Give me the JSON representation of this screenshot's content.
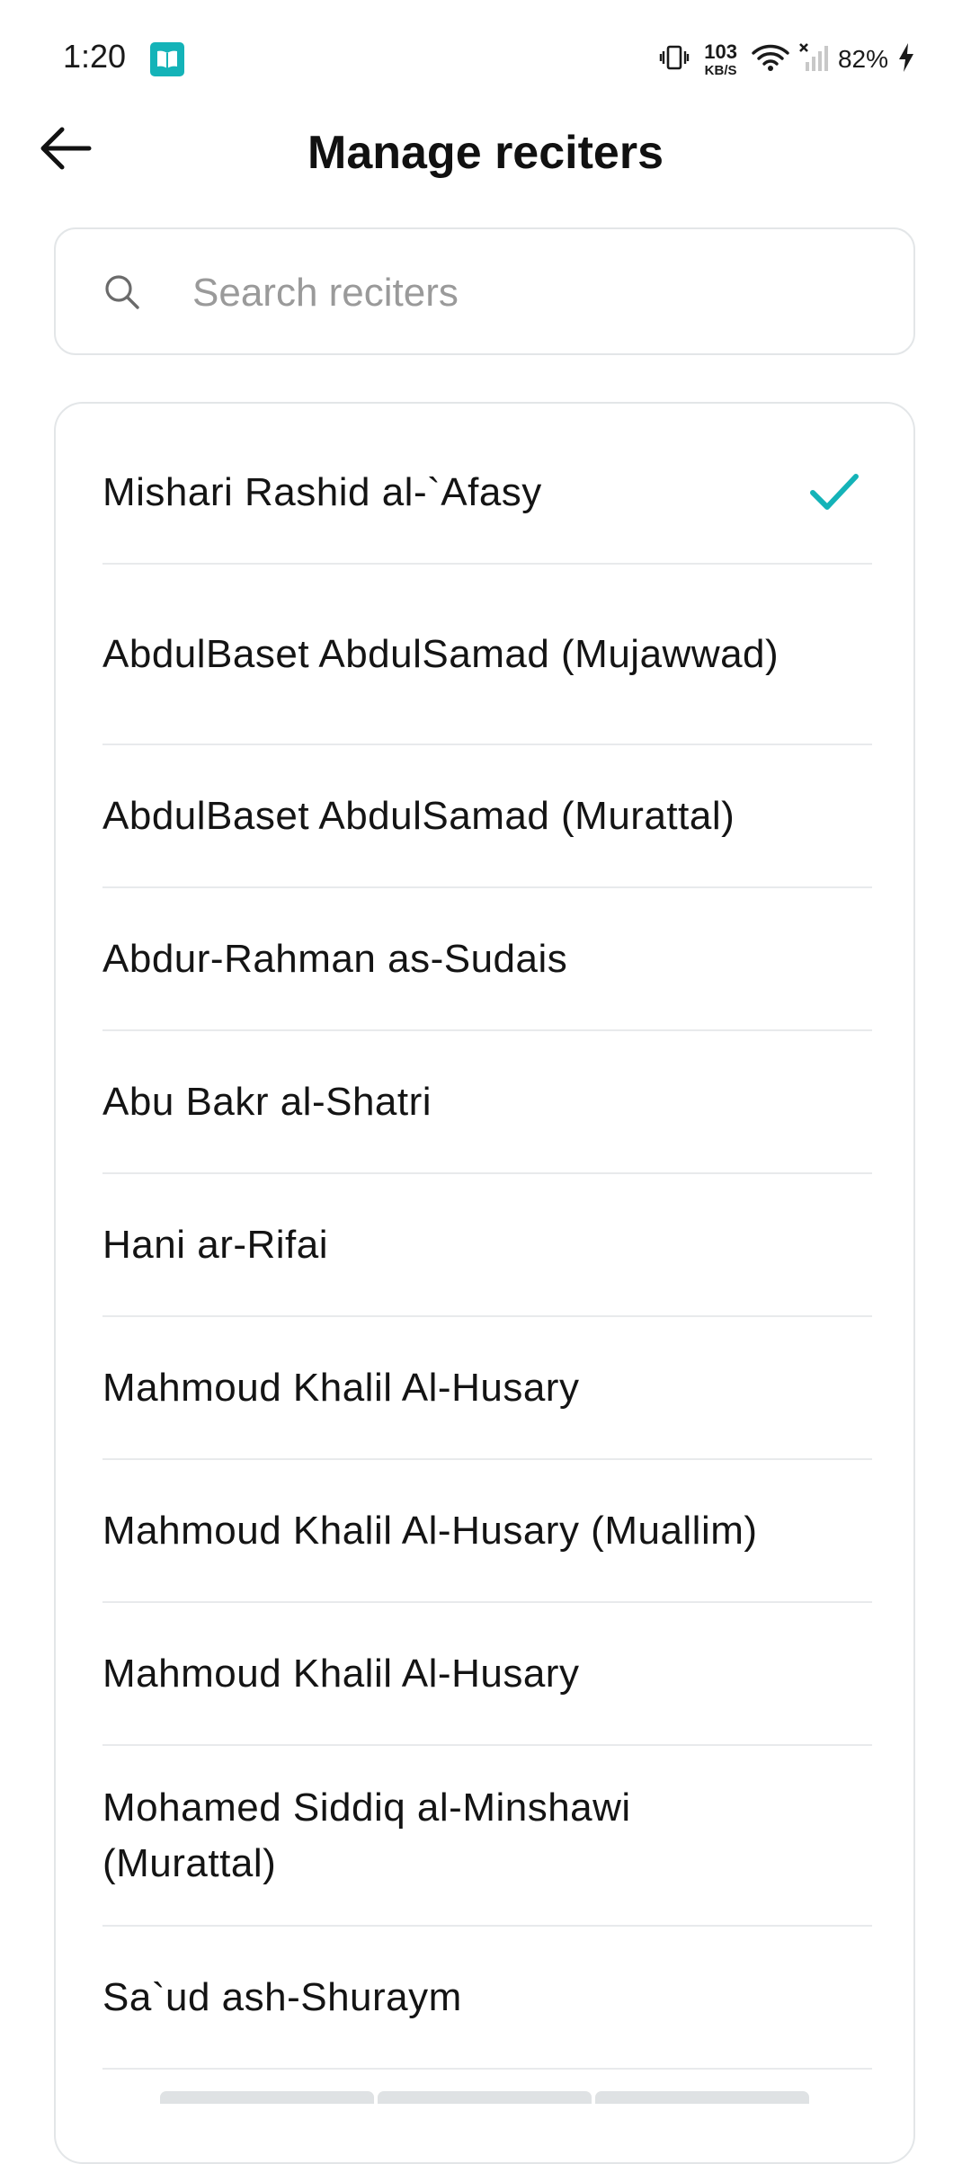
{
  "status_bar": {
    "time": "1:20",
    "net_speed_value": "103",
    "net_speed_unit": "KB/S",
    "battery": "82%",
    "icons": [
      "book-app-icon",
      "vibrate-icon",
      "wifi-icon",
      "signal-off-icon",
      "charging-bolt-icon"
    ]
  },
  "header": {
    "title": "Manage reciters",
    "back_icon": "arrow-left-icon"
  },
  "search": {
    "placeholder": "Search reciters",
    "value": ""
  },
  "reciters": {
    "items": [
      {
        "label": "Mishari Rashid al-`Afasy",
        "selected": true
      },
      {
        "label": "AbdulBaset AbdulSamad (Mujawwad)",
        "selected": false
      },
      {
        "label": "AbdulBaset AbdulSamad (Murattal)",
        "selected": false
      },
      {
        "label": "Abdur-Rahman as-Sudais",
        "selected": false
      },
      {
        "label": "Abu Bakr al-Shatri",
        "selected": false
      },
      {
        "label": "Hani ar-Rifai",
        "selected": false
      },
      {
        "label": "Mahmoud Khalil Al-Husary",
        "selected": false
      },
      {
        "label": "Mahmoud Khalil Al-Husary (Muallim)",
        "selected": false
      },
      {
        "label": "Mahmoud Khalil Al-Husary",
        "selected": false
      },
      {
        "label": "Mohamed Siddiq al-Minshawi (Murattal)",
        "selected": false
      },
      {
        "label": "Sa`ud ash-Shuraym",
        "selected": false
      }
    ]
  },
  "colors": {
    "accent": "#14b3b8",
    "divider": "#e8eaec",
    "text": "#141414",
    "placeholder": "#9a9a9a"
  }
}
